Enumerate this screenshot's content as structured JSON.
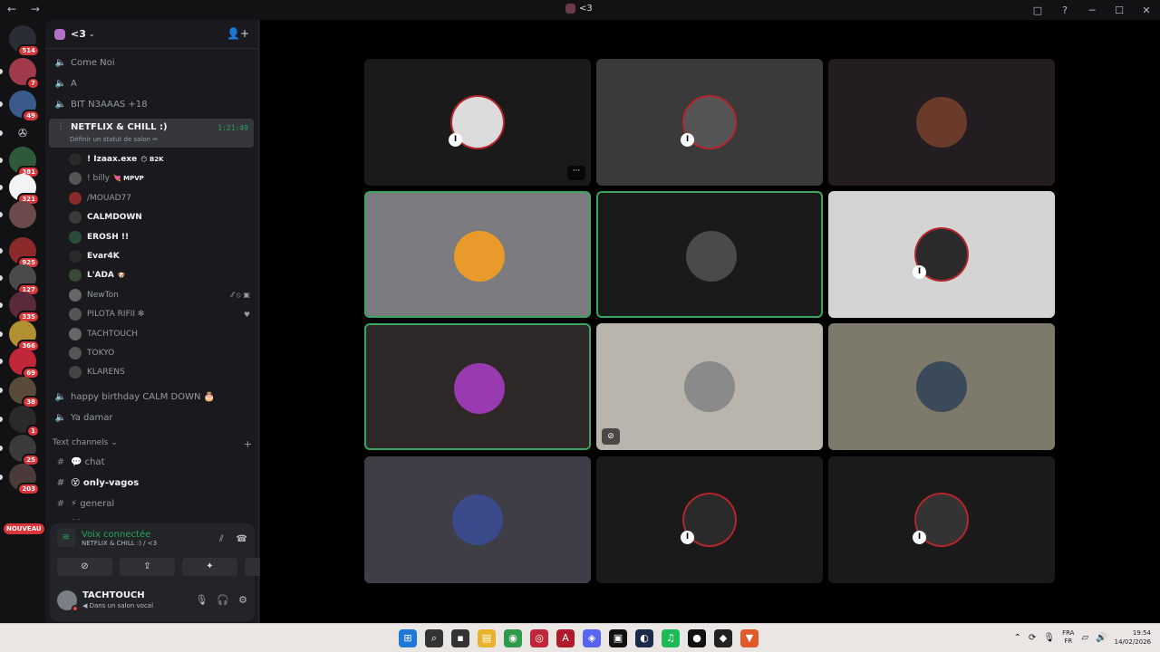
{
  "window": {
    "title": "<3",
    "nav": "← →",
    "controls": [
      "□",
      "?",
      "─",
      "☐",
      "✕"
    ]
  },
  "servers": [
    {
      "badge": "514",
      "color": "#2a2d33"
    },
    {
      "badge": "7",
      "color": "#a03a4a"
    },
    {
      "badge": "49",
      "color": "#3a5a8a"
    },
    {
      "badge": "",
      "color": "#121214",
      "symbol": "✇"
    },
    {
      "badge": "381",
      "color": "#2e5a3a"
    },
    {
      "badge": "321",
      "color": "#f2f3f5"
    },
    {
      "badge": "",
      "color": "#6a4a4a"
    },
    {
      "badge": "925",
      "color": "#8a2a2a"
    },
    {
      "badge": "127",
      "color": "#4a4a4a"
    },
    {
      "badge": "335",
      "color": "#5a2a3a"
    },
    {
      "badge": "366",
      "color": "#b09030"
    },
    {
      "badge": "69",
      "color": "#c0283a"
    },
    {
      "badge": "38",
      "color": "#5a4a3a"
    },
    {
      "badge": "1",
      "color": "#2a2a2a"
    },
    {
      "badge": "25",
      "color": "#3a3a3a"
    },
    {
      "badge": "203",
      "color": "#4a3a3a"
    }
  ],
  "new_label": "NOUVEAU",
  "guild": {
    "name": "<3",
    "chevron": "⌄",
    "invite_icon": "👤+"
  },
  "voice_channels_top": [
    {
      "name": "Come Noi"
    },
    {
      "name": "A"
    },
    {
      "name": "BIT N3AAAS +18"
    }
  ],
  "active_channel": {
    "name": "NETFLIX & CHILL :)",
    "status": "Définir un statut de salon ✏",
    "timer": "1:21:49"
  },
  "voice_users": [
    {
      "name": "! Izaax.exe",
      "tag": "😶 B2K",
      "bold": true,
      "color": "#2a2a2a"
    },
    {
      "name": "! billy",
      "tag": "💘 MPVP",
      "bold": false,
      "color": "#555"
    },
    {
      "name": "/MOUAD77",
      "tag": "",
      "bold": false,
      "color": "#8a2a2a"
    },
    {
      "name": "CALMDOWN",
      "tag": "",
      "bold": true,
      "color": "#3a3a3a"
    },
    {
      "name": "EROSH !!",
      "tag": "",
      "bold": true,
      "color": "#2a4a3a"
    },
    {
      "name": "Evar4K",
      "tag": "",
      "bold": true,
      "color": "#2a2a2a"
    },
    {
      "name": "L'ADA",
      "tag": "🐶",
      "bold": true,
      "color": "#3a4a3a"
    },
    {
      "name": "NewTon",
      "tag": "",
      "bold": false,
      "color": "#666",
      "icons": "⁄⁄ ⦸ ▣"
    },
    {
      "name": "PILOTA RIFII ✻",
      "tag": "",
      "bold": false,
      "color": "#555",
      "icons": "♥"
    },
    {
      "name": "TACHTOUCH",
      "tag": "",
      "bold": false,
      "color": "#666"
    },
    {
      "name": "TOKYO",
      "tag": "",
      "bold": false,
      "color": "#555"
    },
    {
      "name": "KLARENS",
      "tag": "",
      "bold": false,
      "color": "#444"
    }
  ],
  "voice_channels_bottom": [
    {
      "name": "happy birthday CALM DOWN 🎂"
    },
    {
      "name": "Ya damar"
    }
  ],
  "text_category": {
    "label": "Text channels",
    "chevron": "⌄",
    "add": "+"
  },
  "text_channels": [
    {
      "name": "💬 chat",
      "bold": false
    },
    {
      "name": "😵 only-vagos",
      "bold": true
    },
    {
      "name": "⚡ general",
      "bold": false
    },
    {
      "name": "💚 kick_alert",
      "bold": false
    }
  ],
  "voice_panel": {
    "title": "Voix connectée",
    "subtitle": "NETFLIX & CHILL :) / <3",
    "buttons": [
      "⊘",
      "⇪",
      "✦",
      "✿"
    ]
  },
  "user_panel": {
    "name": "TACHTOUCH",
    "status": "◀ Dans un salon vocal"
  },
  "tiles": [
    {
      "bg": "#1a1a1a",
      "avatar": "#dcdcdc",
      "ring": true,
      "mini": true,
      "more": true,
      "speak": false
    },
    {
      "bg": "#3a3a3a",
      "avatar": "#555555",
      "ring": true,
      "mini": true,
      "more": false,
      "speak": false
    },
    {
      "bg": "#231d21",
      "avatar": "#6a3a2a",
      "ring": false,
      "mini": false,
      "more": false,
      "speak": false
    },
    {
      "bg": "#7b7b80",
      "avatar": "#e89a2a",
      "ring": false,
      "mini": false,
      "more": false,
      "speak": true
    },
    {
      "bg": "#1a1a1a",
      "avatar": "#4a4a4a",
      "ring": false,
      "mini": false,
      "more": false,
      "speak": true
    },
    {
      "bg": "#d4d4d4",
      "avatar": "#2a2a2a",
      "ring": true,
      "mini": true,
      "more": false,
      "speak": false
    },
    {
      "bg": "#2e2828",
      "avatar": "#9a3ab0",
      "ring": false,
      "mini": false,
      "more": false,
      "speak": true
    },
    {
      "bg": "#bab5ac",
      "avatar": "#8a8a8a",
      "ring": false,
      "mini": false,
      "more": false,
      "speak": false,
      "novid": true
    },
    {
      "bg": "#7d7a6b",
      "avatar": "#3a4a5a",
      "ring": false,
      "mini": false,
      "more": false,
      "speak": false
    },
    {
      "bg": "#3f3e47",
      "avatar": "#3a4a8a",
      "ring": false,
      "mini": false,
      "more": false,
      "speak": false
    },
    {
      "bg": "#1a1a1a",
      "avatar": "#2a2a2a",
      "ring": true,
      "mini": true,
      "more": false,
      "speak": false
    },
    {
      "bg": "#1a1a1a",
      "avatar": "#333333",
      "ring": true,
      "mini": true,
      "more": false,
      "speak": false
    }
  ],
  "more_label": "···",
  "mini_label": "I",
  "taskbar": {
    "apps": [
      {
        "icon": "⊞",
        "color": "#1e78d7"
      },
      {
        "icon": "⌕",
        "color": "#333"
      },
      {
        "icon": "▪",
        "color": "#333"
      },
      {
        "icon": "▤",
        "color": "#e8b22a"
      },
      {
        "icon": "◉",
        "color": "#2e9a4a"
      },
      {
        "icon": "◎",
        "color": "#c0283a"
      },
      {
        "icon": "A",
        "color": "#b01a2a"
      },
      {
        "icon": "◈",
        "color": "#5865f2"
      },
      {
        "icon": "▣",
        "color": "#111"
      },
      {
        "icon": "◐",
        "color": "#1a2a4a"
      },
      {
        "icon": "♫",
        "color": "#1db954"
      },
      {
        "icon": "●",
        "color": "#111"
      },
      {
        "icon": "◆",
        "color": "#222"
      },
      {
        "icon": "▼",
        "color": "#e05a2a"
      }
    ],
    "lang": "FRA",
    "lang_sub": "FR",
    "time": "19:54",
    "date": "14/02/2026"
  }
}
